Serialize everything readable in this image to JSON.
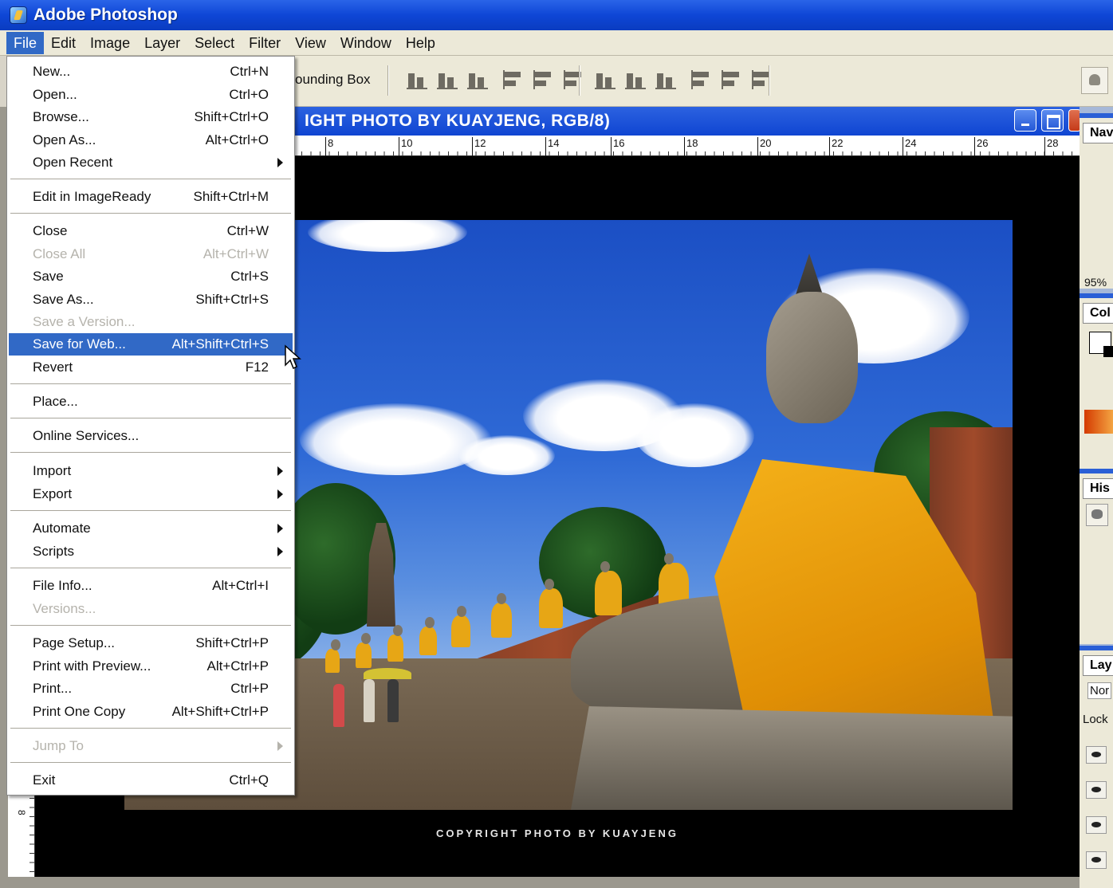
{
  "window": {
    "title": "Adobe Photoshop"
  },
  "menubar": {
    "items": [
      {
        "label": "File",
        "active": true
      },
      {
        "label": "Edit"
      },
      {
        "label": "Image"
      },
      {
        "label": "Layer"
      },
      {
        "label": "Select"
      },
      {
        "label": "Filter"
      },
      {
        "label": "View"
      },
      {
        "label": "Window"
      },
      {
        "label": "Help"
      }
    ]
  },
  "options_bar": {
    "bounding_box_label": "ounding Box"
  },
  "document": {
    "title": "IGHT PHOTO BY KUAYJENG, RGB/8)",
    "ruler_top": [
      "8",
      "10",
      "12",
      "14",
      "16",
      "18",
      "20",
      "22",
      "24",
      "26",
      "28"
    ],
    "ruler_left": "8",
    "watermark": "COPYRIGHT PHOTO BY KUAYJENG"
  },
  "panels": {
    "navigator": {
      "tab": "Nav",
      "zoom": "95%"
    },
    "color": {
      "tab": "Col"
    },
    "history": {
      "tab": "His"
    },
    "layers": {
      "tab": "Lay",
      "blend_mode": "Nor",
      "lock_label": "Lock"
    }
  },
  "file_menu": {
    "items": [
      {
        "label": "New...",
        "shortcut": "Ctrl+N"
      },
      {
        "label": "Open...",
        "shortcut": "Ctrl+O"
      },
      {
        "label": "Browse...",
        "shortcut": "Shift+Ctrl+O"
      },
      {
        "label": "Open As...",
        "shortcut": "Alt+Ctrl+O"
      },
      {
        "label": "Open Recent",
        "shortcut": "",
        "submenu": true
      },
      {
        "label": "Edit in ImageReady",
        "shortcut": "Shift+Ctrl+M"
      },
      {
        "label": "Close",
        "shortcut": "Ctrl+W"
      },
      {
        "label": "Close All",
        "shortcut": "Alt+Ctrl+W",
        "disabled": true
      },
      {
        "label": "Save",
        "shortcut": "Ctrl+S"
      },
      {
        "label": "Save As...",
        "shortcut": "Shift+Ctrl+S"
      },
      {
        "label": "Save a Version...",
        "shortcut": "",
        "disabled": true
      },
      {
        "label": "Save for Web...",
        "shortcut": "Alt+Shift+Ctrl+S",
        "highlight": true
      },
      {
        "label": "Revert",
        "shortcut": "F12"
      },
      {
        "label": "Place...",
        "shortcut": ""
      },
      {
        "label": "Online Services...",
        "shortcut": ""
      },
      {
        "label": "Import",
        "shortcut": "",
        "submenu": true
      },
      {
        "label": "Export",
        "shortcut": "",
        "submenu": true
      },
      {
        "label": "Automate",
        "shortcut": "",
        "submenu": true
      },
      {
        "label": "Scripts",
        "shortcut": "",
        "submenu": true
      },
      {
        "label": "File Info...",
        "shortcut": "Alt+Ctrl+I"
      },
      {
        "label": "Versions...",
        "shortcut": "",
        "disabled": true
      },
      {
        "label": "Page Setup...",
        "shortcut": "Shift+Ctrl+P"
      },
      {
        "label": "Print with Preview...",
        "shortcut": "Alt+Ctrl+P"
      },
      {
        "label": "Print...",
        "shortcut": "Ctrl+P"
      },
      {
        "label": "Print One Copy",
        "shortcut": "Alt+Shift+Ctrl+P"
      },
      {
        "label": "Jump To",
        "shortcut": "",
        "submenu": true,
        "disabled": true
      },
      {
        "label": "Exit",
        "shortcut": "Ctrl+Q"
      }
    ]
  },
  "colors": {
    "xp_blue": "#0e46d6",
    "menu_highlight": "#3169c6",
    "menu_bg": "#ffffff",
    "chrome_bg": "#ece9d8"
  }
}
